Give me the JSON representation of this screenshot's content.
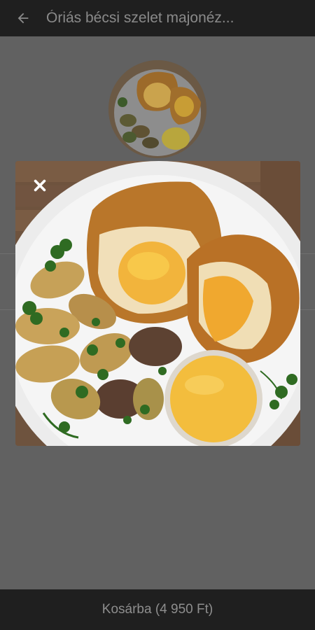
{
  "header": {
    "title": "Óriás bécsi szelet majonéz...",
    "back_icon": "arrow-left-icon"
  },
  "footer": {
    "cart_button_label": "Kosárba (4 950 Ft)"
  },
  "modal": {
    "close_icon": "close-icon"
  },
  "colors": {
    "appbar_bg": "#1f1f1f",
    "overlay_bg": "#616161",
    "header_text": "#8a8a8a"
  }
}
